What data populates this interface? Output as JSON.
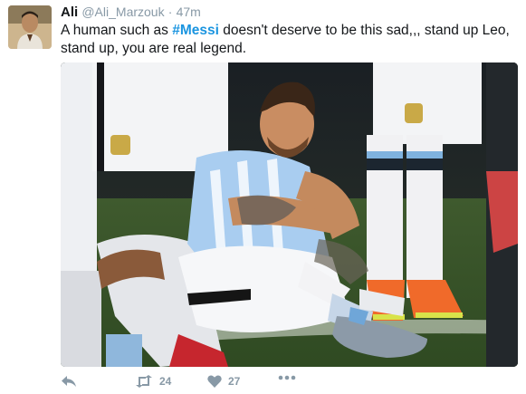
{
  "tweet": {
    "author_name": "Ali",
    "handle": "@Ali_Marzouk",
    "separator": "·",
    "time": "47m",
    "text_before": "A human such as ",
    "hashtag": "#Messi",
    "text_after": " doesn't deserve to be this sad,,, stand up Leo, stand up, you are real legend."
  },
  "actions": {
    "reply_icon": "reply-icon",
    "retweet_icon": "retweet-icon",
    "retweet_count": "24",
    "like_icon": "heart-icon",
    "like_count": "27",
    "more_icon": "more-icon"
  },
  "colors": {
    "hashtag": "#1b95e0",
    "meta": "#8899a6",
    "text": "#14171a"
  }
}
